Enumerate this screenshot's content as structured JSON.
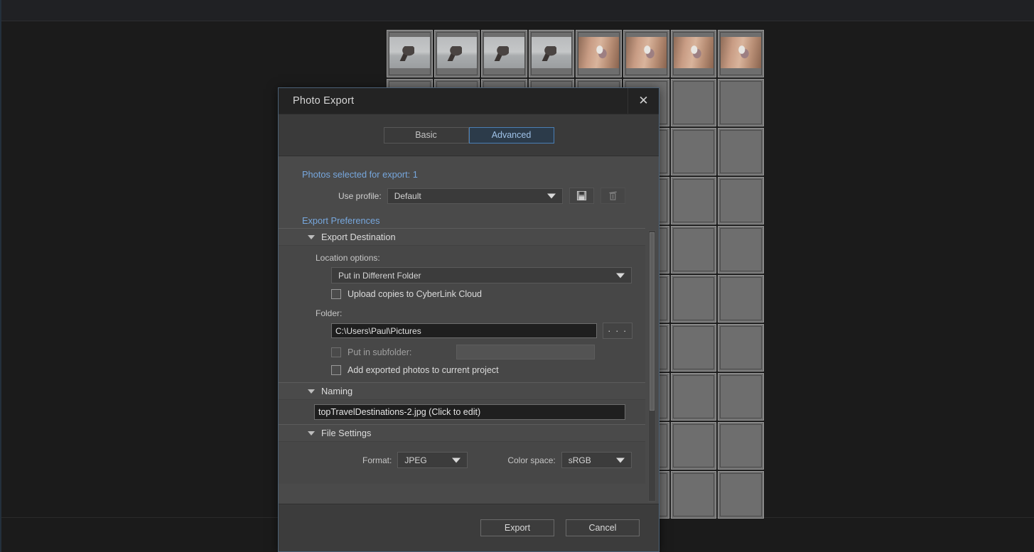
{
  "background": {
    "thumbnails": {
      "rows": 10,
      "cols": 8,
      "kinds": [
        [
          "bat",
          "bat",
          "bat",
          "bat",
          "hand",
          "hand",
          "hand",
          "hand"
        ],
        [
          "empty",
          "empty",
          "empty",
          "empty",
          "empty",
          "empty",
          "empty",
          "empty"
        ],
        [
          "empty",
          "empty",
          "empty",
          "empty",
          "empty",
          "empty",
          "empty",
          "empty"
        ],
        [
          "empty",
          "empty",
          "empty",
          "empty",
          "empty",
          "empty",
          "empty",
          "empty"
        ],
        [
          "empty",
          "empty",
          "empty",
          "empty",
          "empty",
          "empty",
          "empty",
          "empty"
        ],
        [
          "empty",
          "empty",
          "empty",
          "empty",
          "empty",
          "empty",
          "empty",
          "empty"
        ],
        [
          "empty",
          "empty",
          "empty",
          "empty",
          "empty",
          "empty",
          "empty",
          "empty"
        ],
        [
          "empty",
          "empty",
          "empty",
          "empty",
          "empty",
          "empty",
          "empty",
          "empty"
        ],
        [
          "empty",
          "empty",
          "empty",
          "empty",
          "empty",
          "empty",
          "empty",
          "empty"
        ],
        [
          "empty",
          "empty",
          "empty",
          "empty",
          "empty",
          "empty",
          "empty",
          "empty"
        ]
      ]
    }
  },
  "dialog": {
    "title": "Photo Export",
    "close_label": "✕",
    "tabs": [
      {
        "label": "Basic",
        "active": false
      },
      {
        "label": "Advanced",
        "active": true
      }
    ],
    "photos_selected": "Photos selected for export: 1",
    "use_profile_label": "Use profile:",
    "profile_value": "Default",
    "save_profile_icon": "floppy-disk-icon",
    "delete_profile_icon": "trash-can-icon",
    "export_preferences_label": "Export Preferences",
    "groups": {
      "export_destination": {
        "title": "Export Destination",
        "location_options_label": "Location options:",
        "location_value": "Put in Different Folder",
        "upload_label": "Upload copies to CyberLink Cloud",
        "upload_checked": false,
        "folder_label": "Folder:",
        "folder_value": "C:\\Users\\Paul\\Pictures",
        "browse_label": "· · ·",
        "subfolder_label": "Put in subfolder:",
        "subfolder_checked": false,
        "subfolder_value": "",
        "add_to_project_label": "Add exported photos to current project",
        "add_to_project_checked": false
      },
      "naming": {
        "title": "Naming",
        "filename": "topTravelDestinations-2.jpg  (Click to edit)"
      },
      "file_settings": {
        "title": "File Settings",
        "format_label": "Format:",
        "format_value": "JPEG",
        "colorspace_label": "Color space:",
        "colorspace_value": "sRGB"
      }
    },
    "footer": {
      "export_label": "Export",
      "cancel_label": "Cancel"
    }
  },
  "colors": {
    "accent_blue": "#77a7dd",
    "tab_active_border": "#4a7fb5",
    "dialog_bg": "#4a4a4a",
    "titlebar_bg": "#232323"
  }
}
